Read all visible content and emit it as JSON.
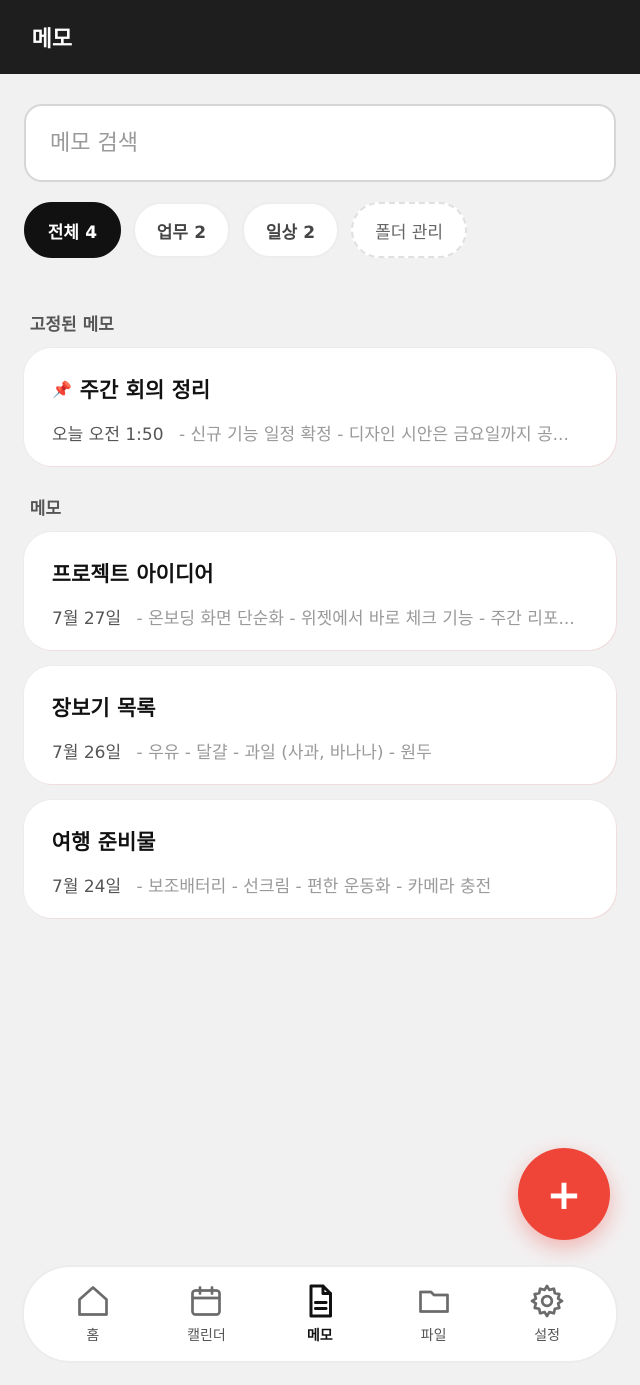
{
  "header": {
    "title": "메모"
  },
  "search": {
    "placeholder": "메모 검색"
  },
  "chips": [
    {
      "label": "전체 4",
      "active": true
    },
    {
      "label": "업무 2"
    },
    {
      "label": "일상 2"
    },
    {
      "label": "폴더 관리"
    }
  ],
  "sections": {
    "pinned_title": "고정된 메모",
    "memos_title": "메모"
  },
  "pinned": [
    {
      "title": "주간 회의 정리",
      "date": "오늘 오전 1:50",
      "preview": "- 신규 기능 일정 확정 - 디자인 시안은 금요일까지 공..."
    }
  ],
  "memos": [
    {
      "title": "프로젝트 아이디어",
      "date": "7월 27일",
      "preview": "- 온보딩 화면 단순화 - 위젯에서 바로 체크 기능 - 주간 리포..."
    },
    {
      "title": "장보기 목록",
      "date": "7월 26일",
      "preview": "- 우유 - 달걀 - 과일 (사과, 바나나) - 원두"
    },
    {
      "title": "여행 준비물",
      "date": "7월 24일",
      "preview": "- 보조배터리 - 선크림 - 편한 운동화 - 카메라 충전"
    }
  ],
  "fab": {
    "label": "+"
  },
  "nav": [
    {
      "label": "홈",
      "icon": "home-icon"
    },
    {
      "label": "캘린더",
      "icon": "calendar-icon"
    },
    {
      "label": "메모",
      "icon": "document-icon",
      "active": true
    },
    {
      "label": "파일",
      "icon": "folder-icon"
    },
    {
      "label": "설정",
      "icon": "gear-icon"
    }
  ],
  "colors": {
    "accent": "#ef4438",
    "header": "#1e1e1e",
    "background": "#f2f1f2"
  }
}
